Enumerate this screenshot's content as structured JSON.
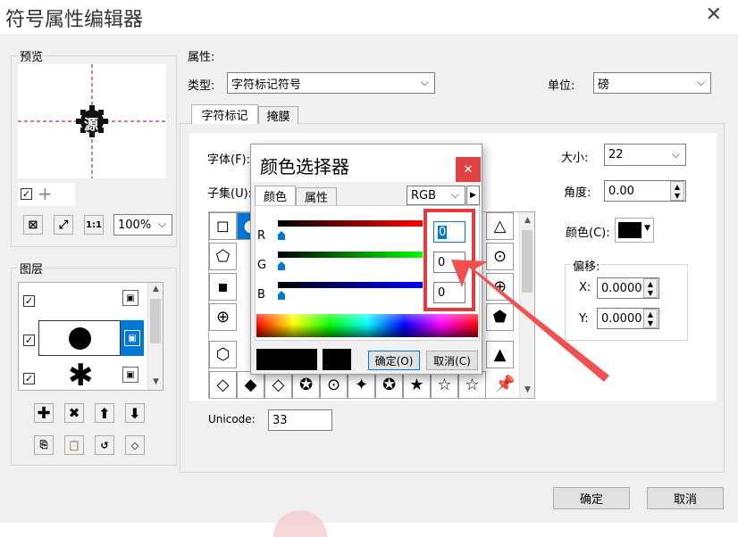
{
  "dialog": {
    "title": "符号属性编辑器",
    "close": "✕",
    "ok": "确定",
    "cancel": "取消"
  },
  "preview": {
    "label": "预览",
    "glyph": "源",
    "zoom": "100%"
  },
  "layers": {
    "label": "图层",
    "rows": [
      {
        "checked": "☑",
        "lock": "🔒"
      },
      {
        "checked": "☑",
        "lock": "🔒"
      },
      {
        "checked": "☑",
        "lock": "🔒"
      }
    ]
  },
  "props": {
    "label": "属性:",
    "type_label": "类型:",
    "type_value": "字符标记符号",
    "unit_label": "单位:",
    "unit_value": "磅",
    "tabs": [
      "字符标记",
      "掩膜"
    ],
    "font_label": "字体(F):",
    "subset_label": "子集(U):",
    "size_label": "大小:",
    "size_value": "22",
    "angle_label": "角度:",
    "angle_value": "0.00",
    "color_label": "颜色(C):",
    "offset_label": "偏移:",
    "x_label": "X:",
    "x_value": "0.0000",
    "y_label": "Y:",
    "y_value": "0.0000",
    "unicode_label": "Unicode:",
    "unicode_value": "33"
  },
  "glyph_rows": [
    [
      "◻",
      "●",
      "",
      "",
      "",
      "",
      "",
      "",
      "",
      "△"
    ],
    [
      "⬠",
      "",
      "",
      "",
      "",
      "",
      "",
      "",
      "",
      "⊙"
    ],
    [
      "▪",
      "",
      "",
      "",
      "",
      "",
      "",
      "",
      "",
      "⊕"
    ],
    [
      "⊕",
      "",
      "",
      "",
      "",
      "",
      "",
      "",
      "",
      "⬟"
    ],
    [
      "⬡",
      "",
      "",
      "",
      "",
      "",
      "",
      "",
      "",
      "▲"
    ],
    [
      "◇",
      "◆",
      "◇",
      "✪",
      "⊙",
      "✦",
      "✪",
      "★",
      "☆",
      "☆"
    ]
  ],
  "color_picker": {
    "title": "颜色选择器",
    "close": "✕",
    "tab_color": "颜色",
    "tab_props": "属性",
    "mode": "RGB",
    "r_label": "R",
    "g_label": "G",
    "b_label": "B",
    "r_value": "0",
    "g_value": "0",
    "b_value": "0",
    "ok": "确定(O)",
    "cancel": "取消(C)"
  },
  "colors": {
    "accent_blue": "#0078d7",
    "highlight_red": "#e03c3c",
    "close_red": "#e04343"
  }
}
